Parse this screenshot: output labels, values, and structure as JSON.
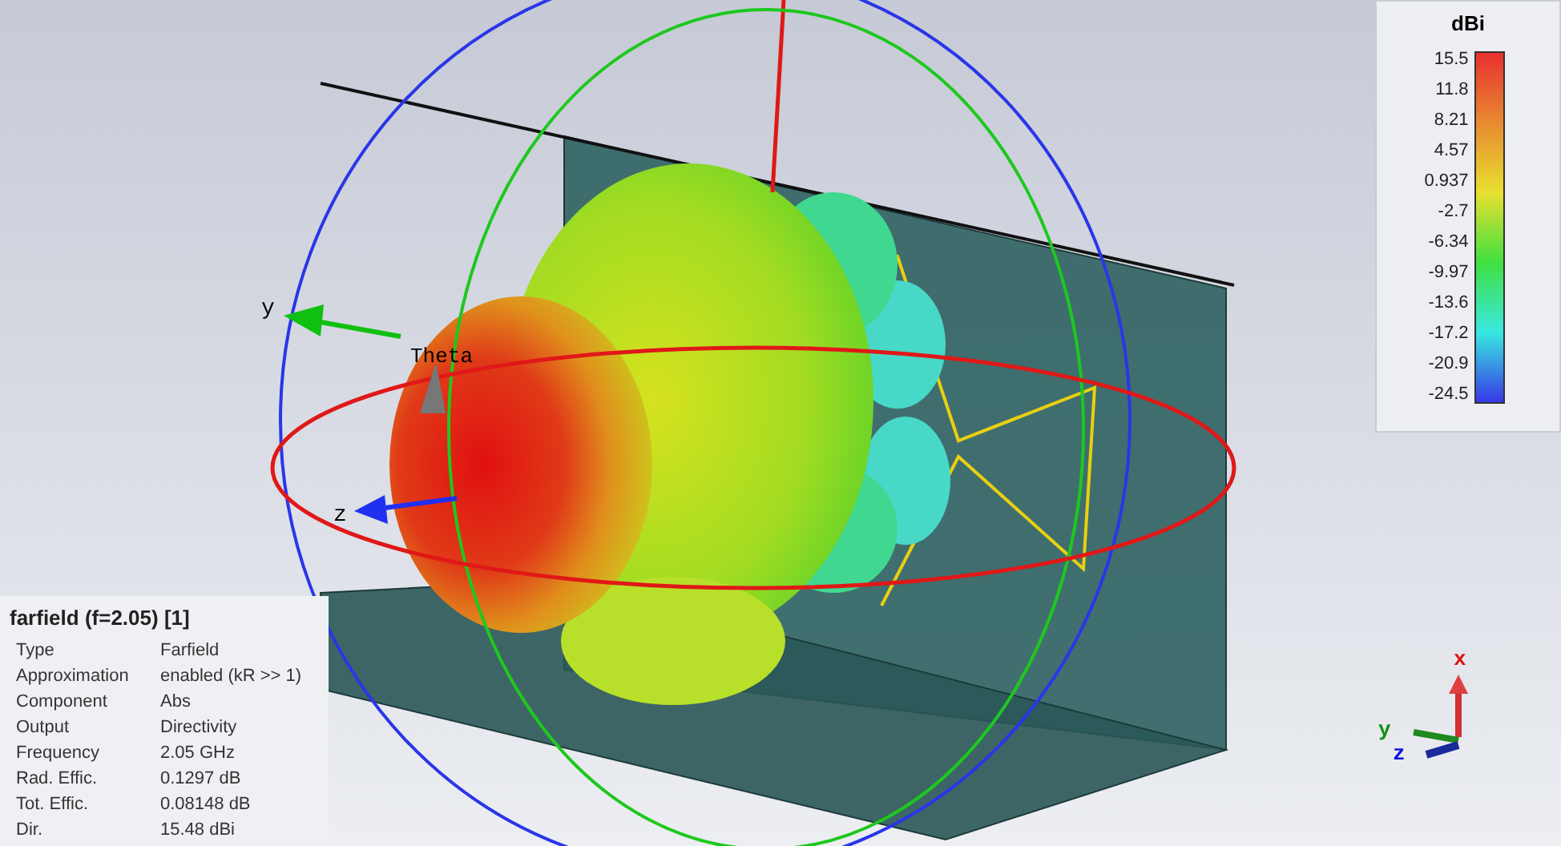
{
  "scene": {
    "y_label": "y",
    "theta_label": "Theta",
    "z_label": "z"
  },
  "legend": {
    "unit": "dBi",
    "ticks": [
      "15.5",
      "11.8",
      "8.21",
      "4.57",
      "0.937",
      "-2.7",
      "-6.34",
      "-9.97",
      "-13.6",
      "-17.2",
      "-20.9",
      "-24.5"
    ]
  },
  "info": {
    "title": "farfield (f=2.05) [1]",
    "rows": [
      {
        "label": "Type",
        "value": "Farfield"
      },
      {
        "label": "Approximation",
        "value": "enabled (kR >> 1)"
      },
      {
        "label": "Component",
        "value": "Abs"
      },
      {
        "label": "Output",
        "value": "Directivity"
      },
      {
        "label": "Frequency",
        "value": "2.05 GHz"
      },
      {
        "label": "Rad. Effic.",
        "value": "0.1297 dB"
      },
      {
        "label": "Tot. Effic.",
        "value": "0.08148 dB"
      },
      {
        "label": "Dir.",
        "value": "15.48 dBi"
      }
    ]
  },
  "triad": {
    "x_label": "x",
    "y_label": "y",
    "z_label": "z"
  }
}
